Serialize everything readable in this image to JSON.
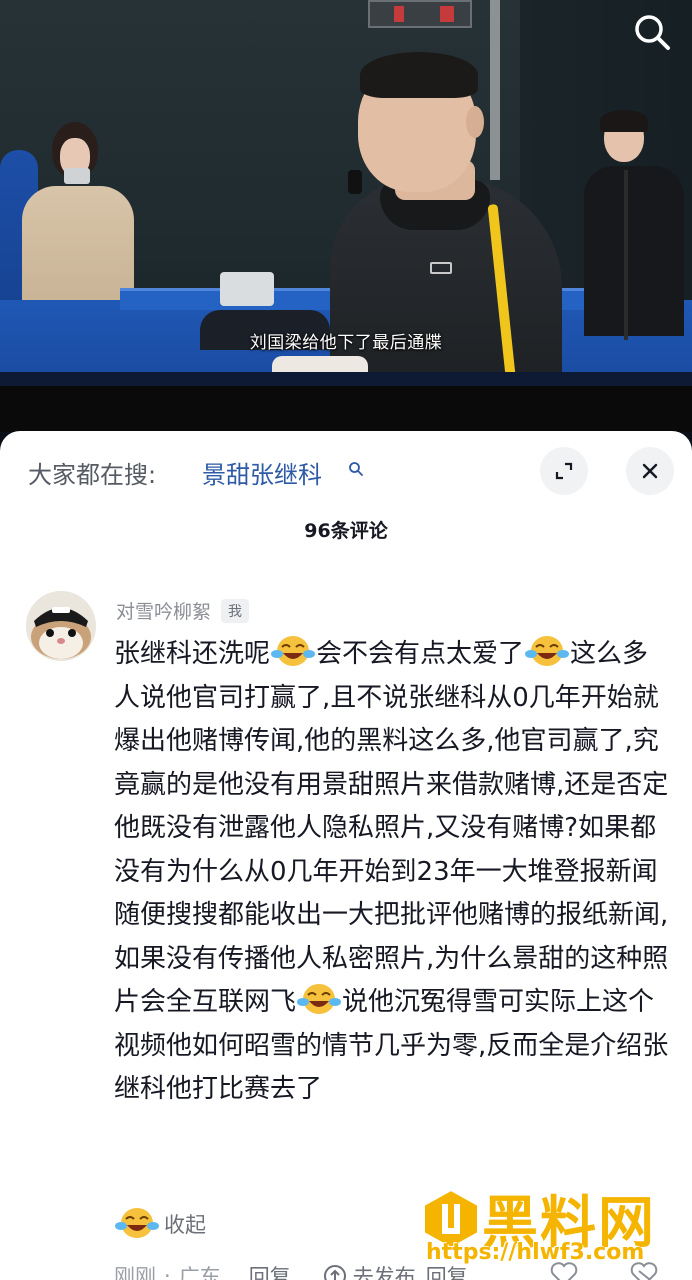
{
  "video": {
    "subtitle": "刘国梁给他下了最后通牒",
    "search_icon": "search-icon"
  },
  "sheet": {
    "trending_label": "大家都在搜:",
    "trending_query": "景甜张继科",
    "comment_count_title": "96条评论",
    "expand_icon": "expand-icon",
    "close_icon": "close-icon"
  },
  "comment": {
    "author": "对雪吟柳絮",
    "me_badge": "我",
    "text_segments": [
      "张继科还洗呢",
      "会不会有点太爱了",
      "这么多人说他官司打赢了,且不说张继科从0几年开始就爆出他赌博传闻,他的黑料这么多,他官司赢了,究竟赢的是他没有用景甜照片来借款赌博,还是否定他既没有泄露他人隐私照片,又没有赌博?如果都没有为什么从0几年开始到23年一大堆登报新闻随便搜搜都能收出一大把批评他赌博的报纸新闻,如果没有传播他人私密照片,为什么景甜的这种照片会全互联网飞",
      "说他沉冤得雪可实际上这个视频他如何昭雪的情节几乎为零,反而全是介绍张继科他打比赛去了"
    ],
    "emoji_name": "laugh-cry-emoji",
    "collapse_label": "收起",
    "time": "刚刚",
    "location": "广东",
    "reply_label": "回复",
    "share_label": "去发布",
    "reply_suffix": "回复"
  },
  "watermark": {
    "brand": "黑料网",
    "url": "https://hlwf3.com"
  }
}
